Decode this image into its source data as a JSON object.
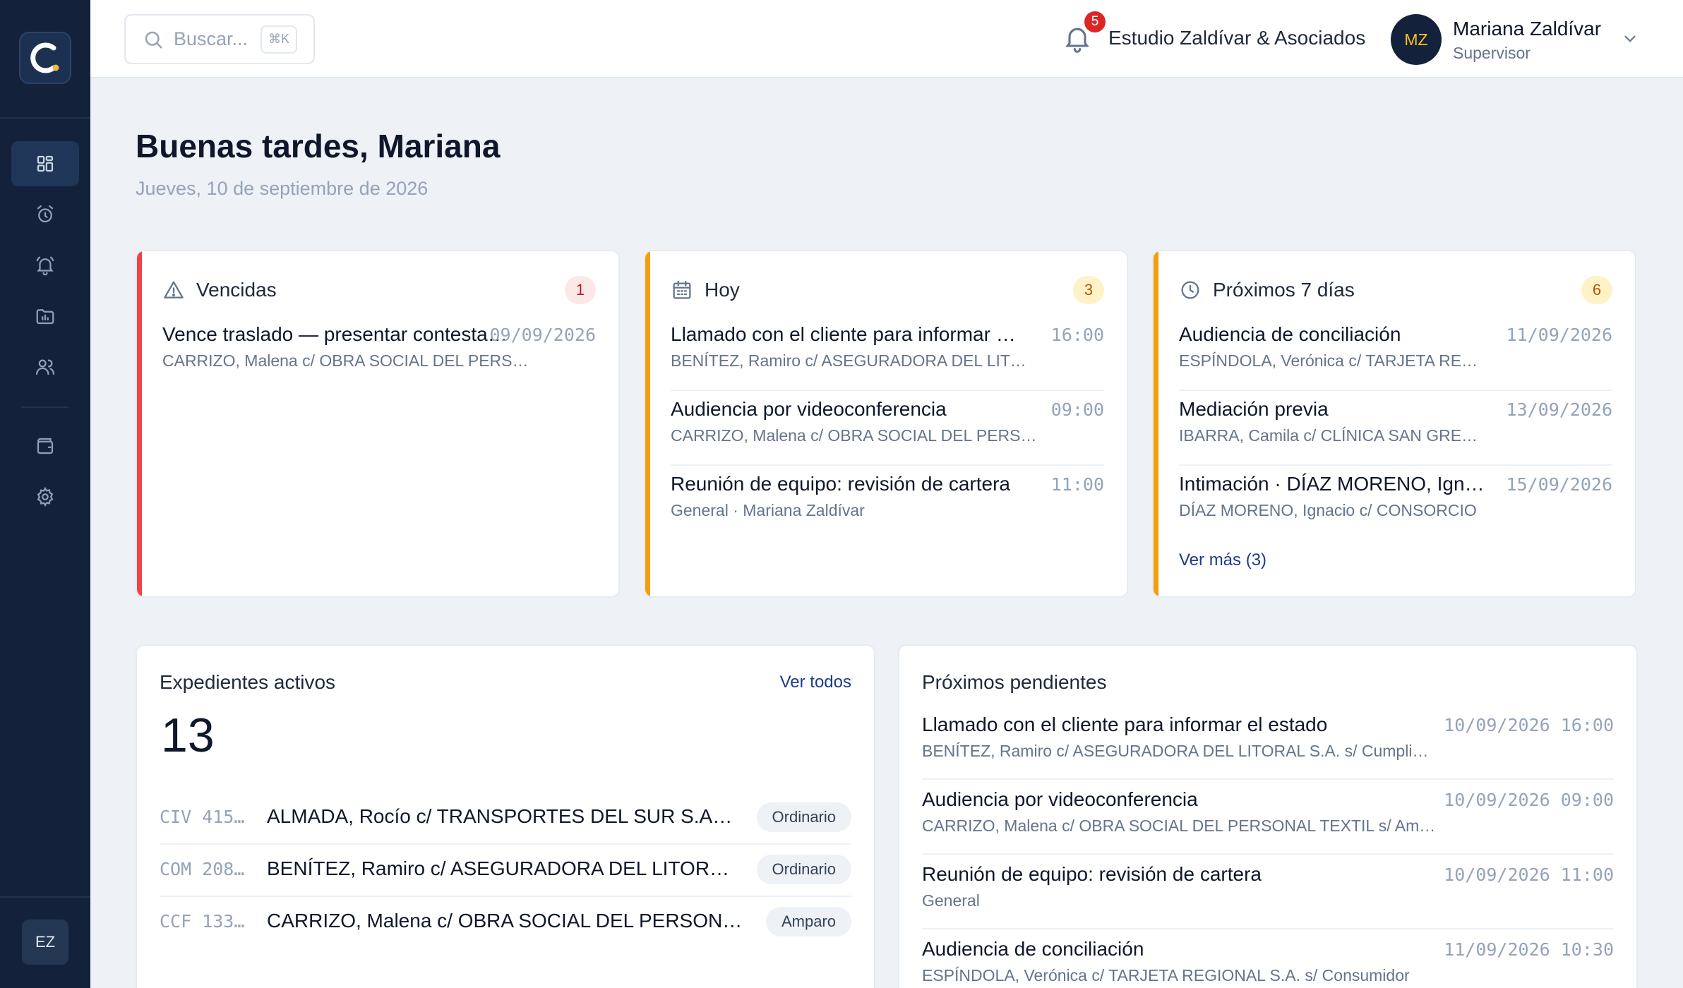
{
  "app": {
    "logo_letter": "C",
    "user_initials_sidebar": "EZ"
  },
  "sidebar": {
    "items": [
      {
        "name": "dashboard-icon",
        "active": true
      },
      {
        "name": "alarm-clock-icon",
        "active": false
      },
      {
        "name": "bell-ring-icon",
        "active": false
      },
      {
        "name": "folder-chart-icon",
        "active": false
      },
      {
        "name": "users-icon",
        "active": false
      },
      {
        "name": "wallet-icon",
        "active": false
      },
      {
        "name": "gear-icon",
        "active": false
      }
    ]
  },
  "topbar": {
    "search_placeholder": "Buscar...",
    "search_shortcut": "⌘K",
    "notification_count": "5",
    "org_name": "Estudio Zaldívar & Asociados",
    "user_initials": "MZ",
    "user_name": "Mariana Zaldívar",
    "user_role": "Supervisor"
  },
  "greeting": {
    "title": "Buenas tardes, Mariana",
    "date": "Jueves, 10 de septiembre de 2026"
  },
  "cards": {
    "vencidas": {
      "title": "Vencidas",
      "count": "1",
      "accent": "#ef4444",
      "items": [
        {
          "title": "Vence traslado — presentar contestación de demanda",
          "sub": "CARRIZO, Malena c/ OBRA SOCIAL DEL PERSONAL TEXTIL",
          "when": "09/09/2026"
        }
      ]
    },
    "hoy": {
      "title": "Hoy",
      "count": "3",
      "accent": "#f59e0b",
      "items": [
        {
          "title": "Llamado con el cliente para informar el estado",
          "sub": "BENÍTEZ, Ramiro c/ ASEGURADORA DEL LITORAL S.A.",
          "when": "16:00"
        },
        {
          "title": "Audiencia por videoconferencia",
          "sub": "CARRIZO, Malena c/ OBRA SOCIAL DEL PERSONAL TEXTIL",
          "when": "09:00"
        },
        {
          "title": "Reunión de equipo: revisión de cartera",
          "sub": "General · Mariana Zaldívar",
          "when": "11:00"
        }
      ]
    },
    "proximos": {
      "title": "Próximos 7 días",
      "count": "6",
      "accent": "#f59e0b",
      "items": [
        {
          "title": "Audiencia de conciliación",
          "sub": "ESPÍNDOLA, Verónica c/ TARJETA REGIONAL S.A.",
          "when": "11/09/2026"
        },
        {
          "title": "Mediación previa",
          "sub": "IBARRA, Camila c/ CLÍNICA SAN GREGORIO",
          "when": "13/09/2026"
        },
        {
          "title": "Intimación · DÍAZ MORENO, Ignacio",
          "sub": "DÍAZ MORENO, Ignacio c/ CONSORCIO",
          "when": "15/09/2026"
        }
      ],
      "more": "Ver más (3)"
    }
  },
  "expedientes": {
    "title": "Expedientes activos",
    "link": "Ver todos",
    "count": "13",
    "rows": [
      {
        "code": "CIV 415…",
        "title": "ALMADA, Rocío c/ TRANSPORTES DEL SUR S.A. s/ Daños y perjuicios",
        "tag": "Ordinario"
      },
      {
        "code": "COM 208…",
        "title": "BENÍTEZ, Ramiro c/ ASEGURADORA DEL LITORAL S.A.",
        "tag": "Ordinario"
      },
      {
        "code": "CCF 133…",
        "title": "CARRIZO, Malena c/ OBRA SOCIAL DEL PERSONAL TEXTIL",
        "tag": "Amparo"
      }
    ]
  },
  "pendientes": {
    "title": "Próximos pendientes",
    "rows": [
      {
        "title": "Llamado con el cliente para informar el estado",
        "sub": "BENÍTEZ, Ramiro c/ ASEGURADORA DEL LITORAL S.A. s/ Cumplimiento de contrato",
        "when": "10/09/2026 16:00"
      },
      {
        "title": "Audiencia por videoconferencia",
        "sub": "CARRIZO, Malena c/ OBRA SOCIAL DEL PERSONAL TEXTIL s/ Amparo de salud",
        "when": "10/09/2026 09:00"
      },
      {
        "title": "Reunión de equipo: revisión de cartera",
        "sub": "General",
        "when": "10/09/2026 11:00"
      },
      {
        "title": "Audiencia de conciliación",
        "sub": "ESPÍNDOLA, Verónica c/ TARJETA REGIONAL S.A. s/ Consumidor",
        "when": "11/09/2026 10:30"
      }
    ]
  }
}
